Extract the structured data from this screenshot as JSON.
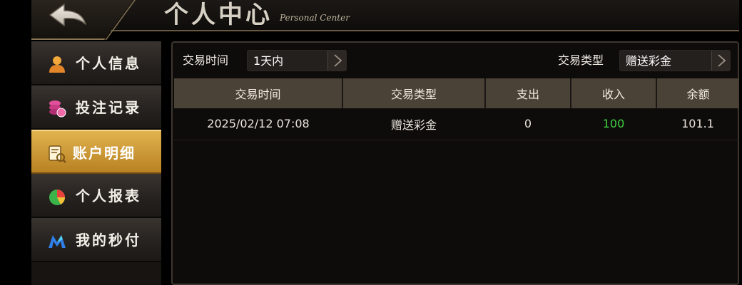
{
  "header": {
    "title": "个人中心",
    "subtitle": "Personal Center",
    "back_icon": "back-arrow-icon"
  },
  "sidebar": {
    "items": [
      {
        "label": "个人信息",
        "icon": "user-icon",
        "active": false
      },
      {
        "label": "投注记录",
        "icon": "chips-icon",
        "active": false
      },
      {
        "label": "账户明细",
        "icon": "ledger-search-icon",
        "active": true
      },
      {
        "label": "个人报表",
        "icon": "pie-chart-icon",
        "active": false
      },
      {
        "label": "我的秒付",
        "icon": "m-logo-icon",
        "active": false
      }
    ]
  },
  "filters": {
    "time_label": "交易时间",
    "time_value": "1天内",
    "type_label": "交易类型",
    "type_value": "赠送彩金"
  },
  "table": {
    "headers": [
      "交易时间",
      "交易类型",
      "支出",
      "收入",
      "余额"
    ],
    "rows": [
      [
        "2025/02/12 07:08",
        "赠送彩金",
        "0",
        "100",
        "101.1"
      ]
    ]
  },
  "colors": {
    "accent_gold": "#c9922c",
    "income_green": "#3fd13f",
    "header_bg": "#4a4236"
  }
}
